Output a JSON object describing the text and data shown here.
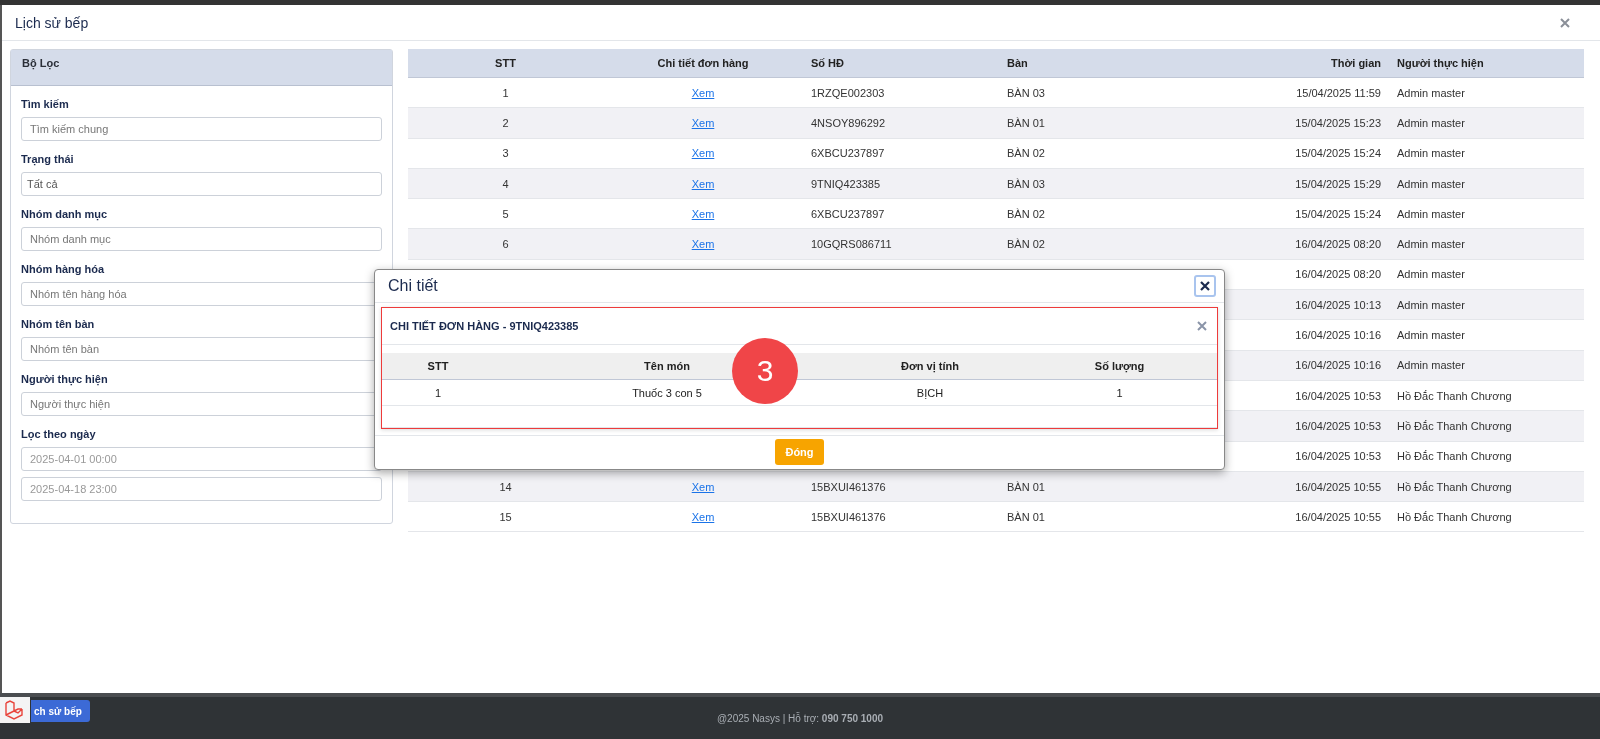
{
  "window": {
    "title": "Lịch sử bếp"
  },
  "filter": {
    "title": "Bộ Lọc",
    "fields": [
      {
        "label": "Tìm kiếm",
        "placeholder": "Tìm kiếm chung"
      },
      {
        "label": "Trạng thái",
        "value": "Tất cả"
      },
      {
        "label": "Nhóm danh mục",
        "placeholder": "Nhóm danh mục"
      },
      {
        "label": "Nhóm hàng hóa",
        "placeholder": "Nhóm tên hàng hóa"
      },
      {
        "label": "Nhóm tên bàn",
        "placeholder": "Nhóm tên bàn"
      },
      {
        "label": "Người thực hiện",
        "placeholder": "Người thực hiện"
      }
    ],
    "date_filter": {
      "label": "Lọc theo ngày",
      "from": "2025-04-01 00:00",
      "to": "2025-04-18 23:00"
    }
  },
  "table": {
    "columns": [
      "STT",
      "Chi tiết đơn hàng",
      "Số HĐ",
      "Bàn",
      "Thời gian",
      "Người thực hiện"
    ],
    "rows": [
      {
        "stt": "1",
        "link": "Xem",
        "invoice": "1RZQE002303",
        "table": "BÀN 03",
        "time": "15/04/2025 11:59",
        "user": "Admin master"
      },
      {
        "stt": "2",
        "link": "Xem",
        "invoice": "4NSOY896292",
        "table": "BÀN 01",
        "time": "15/04/2025 15:23",
        "user": "Admin master"
      },
      {
        "stt": "3",
        "link": "Xem",
        "invoice": "6XBCU237897",
        "table": "BÀN 02",
        "time": "15/04/2025 15:24",
        "user": "Admin master"
      },
      {
        "stt": "4",
        "link": "Xem",
        "invoice": "9TNIQ423385",
        "table": "BÀN 03",
        "time": "15/04/2025 15:29",
        "user": "Admin master"
      },
      {
        "stt": "5",
        "link": "Xem",
        "invoice": "6XBCU237897",
        "table": "BÀN 02",
        "time": "15/04/2025 15:24",
        "user": "Admin master"
      },
      {
        "stt": "6",
        "link": "Xem",
        "invoice": "10GQRS086711",
        "table": "BÀN 02",
        "time": "16/04/2025 08:20",
        "user": "Admin master"
      },
      {
        "time": "16/04/2025 08:20",
        "user": "Admin master"
      },
      {
        "time": "16/04/2025 10:13",
        "user": "Admin master"
      },
      {
        "time": "16/04/2025 10:16",
        "user": "Admin master"
      },
      {
        "time": "16/04/2025 10:16",
        "user": "Admin master"
      },
      {
        "time": "16/04/2025 10:53",
        "user": "Hồ Đắc Thanh Chương"
      },
      {
        "time": "16/04/2025 10:53",
        "user": "Hồ Đắc Thanh Chương"
      },
      {
        "time": "16/04/2025 10:53",
        "user": "Hồ Đắc Thanh Chương"
      },
      {
        "stt": "14",
        "link": "Xem",
        "invoice": "15BXUI461376",
        "table": "BÀN 01",
        "time": "16/04/2025 10:55",
        "user": "Hồ Đắc Thanh Chương"
      },
      {
        "stt": "15",
        "link": "Xem",
        "invoice": "15BXUI461376",
        "table": "BÀN 01",
        "time": "16/04/2025 10:55",
        "user": "Hồ Đắc Thanh Chương"
      }
    ]
  },
  "modal": {
    "title": "Chi tiết",
    "card_title": "CHI TIẾT ĐƠN HÀNG - 9TNIQ423385",
    "columns": [
      "STT",
      "Tên món",
      "Đơn vị tính",
      "Số lượng"
    ],
    "rows": [
      {
        "stt": "1",
        "name": "Thuốc 3 con 5",
        "unit": "BỊCH",
        "qty": "1"
      }
    ],
    "button": "Đóng"
  },
  "annotation": {
    "label": "3"
  },
  "footer": {
    "taskbar_tab": "ch sử bếp",
    "copyright": "@2025 Nasys | Hỗ trợ: **090 750 1000**"
  }
}
